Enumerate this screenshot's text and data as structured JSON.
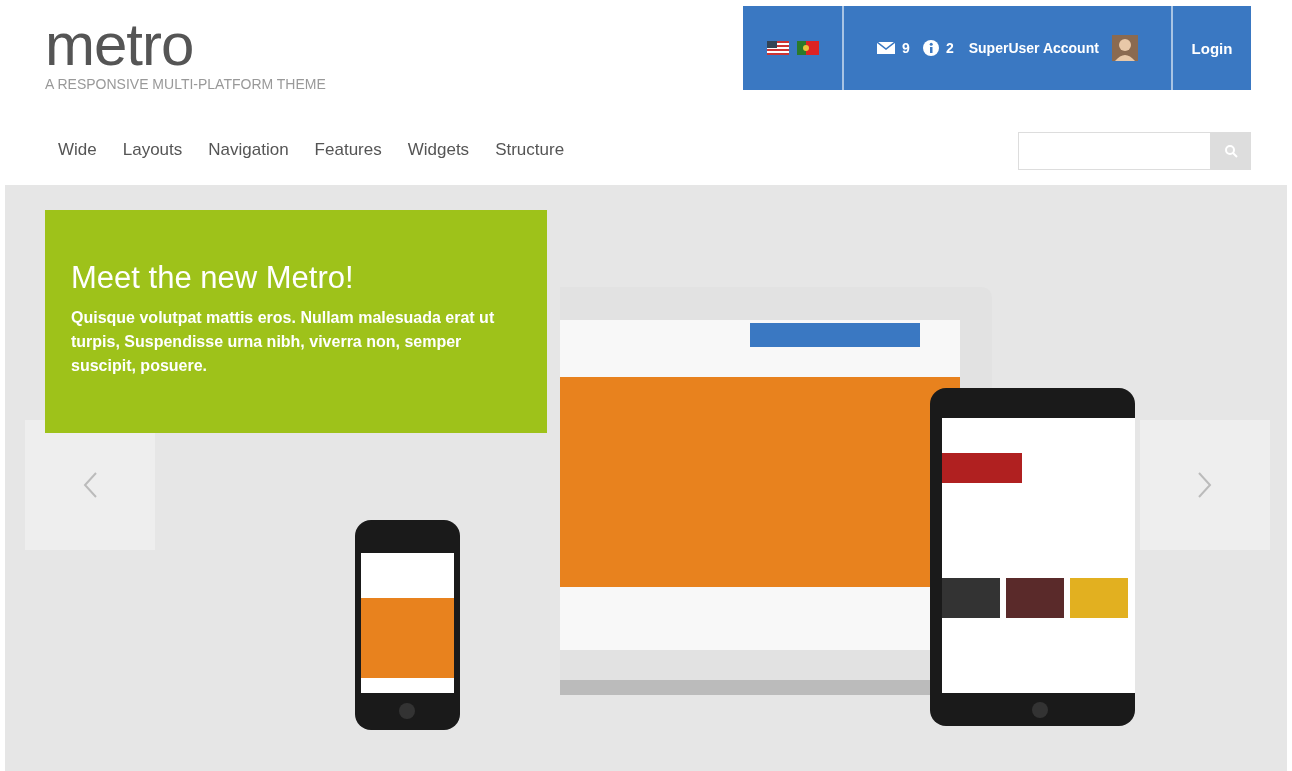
{
  "logo": {
    "title": "metro",
    "tagline": "A RESPONSIVE MULTI-PLATFORM THEME"
  },
  "top_bar": {
    "messages": "9",
    "notifications": "2",
    "account": "SuperUser Account",
    "login": "Login"
  },
  "nav": [
    {
      "label": "Wide"
    },
    {
      "label": "Layouts"
    },
    {
      "label": "Navigation"
    },
    {
      "label": "Features"
    },
    {
      "label": "Widgets"
    },
    {
      "label": "Structure"
    }
  ],
  "hero": {
    "heading": "Meet the new Metro!",
    "text": "Quisque volutpat mattis eros. Nullam malesuada erat ut turpis, Suspendisse urna nibh, viverra non, semper suscipit, posuere."
  }
}
